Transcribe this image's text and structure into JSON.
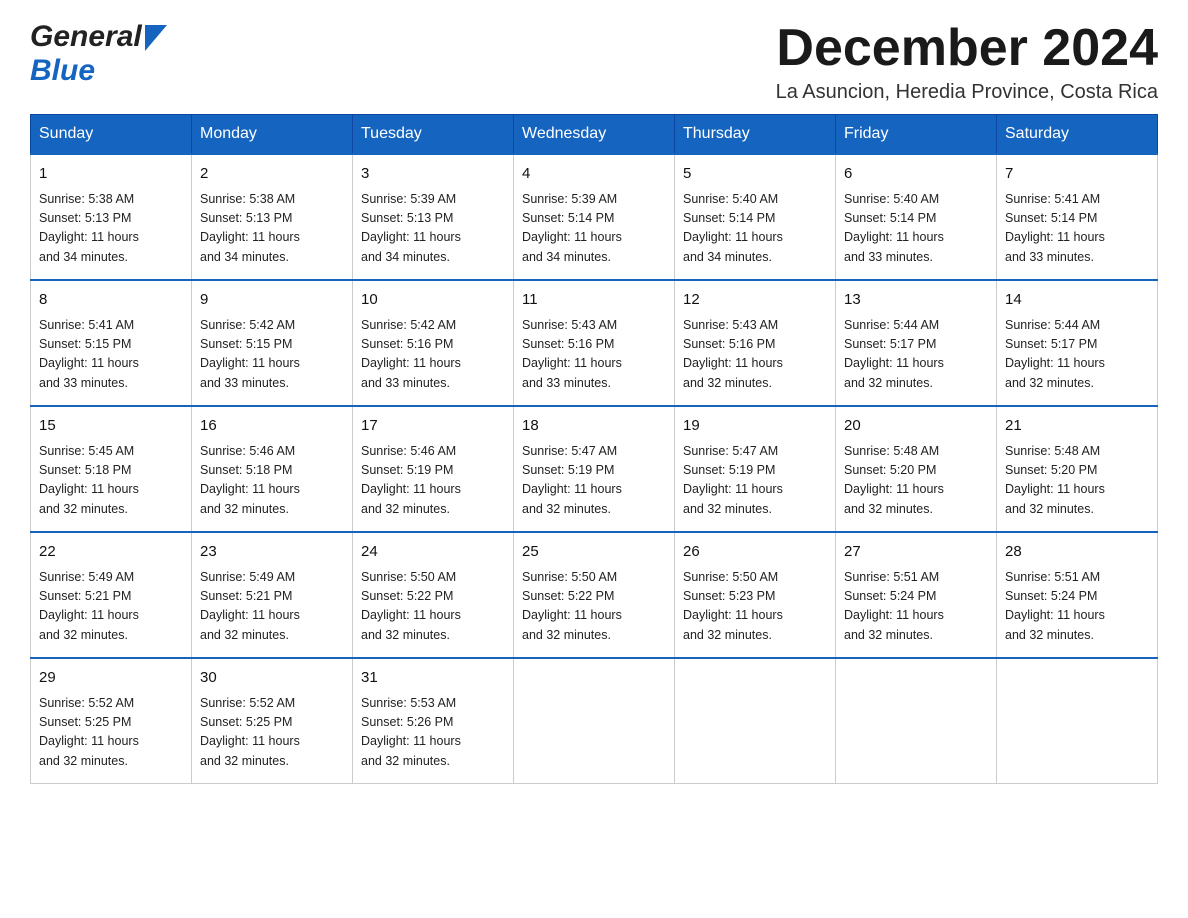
{
  "logo": {
    "general": "General",
    "blue": "Blue"
  },
  "header": {
    "month": "December 2024",
    "location": "La Asuncion, Heredia Province, Costa Rica"
  },
  "days_of_week": [
    "Sunday",
    "Monday",
    "Tuesday",
    "Wednesday",
    "Thursday",
    "Friday",
    "Saturday"
  ],
  "weeks": [
    [
      {
        "day": "1",
        "sunrise": "5:38 AM",
        "sunset": "5:13 PM",
        "daylight": "11 hours and 34 minutes."
      },
      {
        "day": "2",
        "sunrise": "5:38 AM",
        "sunset": "5:13 PM",
        "daylight": "11 hours and 34 minutes."
      },
      {
        "day": "3",
        "sunrise": "5:39 AM",
        "sunset": "5:13 PM",
        "daylight": "11 hours and 34 minutes."
      },
      {
        "day": "4",
        "sunrise": "5:39 AM",
        "sunset": "5:14 PM",
        "daylight": "11 hours and 34 minutes."
      },
      {
        "day": "5",
        "sunrise": "5:40 AM",
        "sunset": "5:14 PM",
        "daylight": "11 hours and 34 minutes."
      },
      {
        "day": "6",
        "sunrise": "5:40 AM",
        "sunset": "5:14 PM",
        "daylight": "11 hours and 33 minutes."
      },
      {
        "day": "7",
        "sunrise": "5:41 AM",
        "sunset": "5:14 PM",
        "daylight": "11 hours and 33 minutes."
      }
    ],
    [
      {
        "day": "8",
        "sunrise": "5:41 AM",
        "sunset": "5:15 PM",
        "daylight": "11 hours and 33 minutes."
      },
      {
        "day": "9",
        "sunrise": "5:42 AM",
        "sunset": "5:15 PM",
        "daylight": "11 hours and 33 minutes."
      },
      {
        "day": "10",
        "sunrise": "5:42 AM",
        "sunset": "5:16 PM",
        "daylight": "11 hours and 33 minutes."
      },
      {
        "day": "11",
        "sunrise": "5:43 AM",
        "sunset": "5:16 PM",
        "daylight": "11 hours and 33 minutes."
      },
      {
        "day": "12",
        "sunrise": "5:43 AM",
        "sunset": "5:16 PM",
        "daylight": "11 hours and 32 minutes."
      },
      {
        "day": "13",
        "sunrise": "5:44 AM",
        "sunset": "5:17 PM",
        "daylight": "11 hours and 32 minutes."
      },
      {
        "day": "14",
        "sunrise": "5:44 AM",
        "sunset": "5:17 PM",
        "daylight": "11 hours and 32 minutes."
      }
    ],
    [
      {
        "day": "15",
        "sunrise": "5:45 AM",
        "sunset": "5:18 PM",
        "daylight": "11 hours and 32 minutes."
      },
      {
        "day": "16",
        "sunrise": "5:46 AM",
        "sunset": "5:18 PM",
        "daylight": "11 hours and 32 minutes."
      },
      {
        "day": "17",
        "sunrise": "5:46 AM",
        "sunset": "5:19 PM",
        "daylight": "11 hours and 32 minutes."
      },
      {
        "day": "18",
        "sunrise": "5:47 AM",
        "sunset": "5:19 PM",
        "daylight": "11 hours and 32 minutes."
      },
      {
        "day": "19",
        "sunrise": "5:47 AM",
        "sunset": "5:19 PM",
        "daylight": "11 hours and 32 minutes."
      },
      {
        "day": "20",
        "sunrise": "5:48 AM",
        "sunset": "5:20 PM",
        "daylight": "11 hours and 32 minutes."
      },
      {
        "day": "21",
        "sunrise": "5:48 AM",
        "sunset": "5:20 PM",
        "daylight": "11 hours and 32 minutes."
      }
    ],
    [
      {
        "day": "22",
        "sunrise": "5:49 AM",
        "sunset": "5:21 PM",
        "daylight": "11 hours and 32 minutes."
      },
      {
        "day": "23",
        "sunrise": "5:49 AM",
        "sunset": "5:21 PM",
        "daylight": "11 hours and 32 minutes."
      },
      {
        "day": "24",
        "sunrise": "5:50 AM",
        "sunset": "5:22 PM",
        "daylight": "11 hours and 32 minutes."
      },
      {
        "day": "25",
        "sunrise": "5:50 AM",
        "sunset": "5:22 PM",
        "daylight": "11 hours and 32 minutes."
      },
      {
        "day": "26",
        "sunrise": "5:50 AM",
        "sunset": "5:23 PM",
        "daylight": "11 hours and 32 minutes."
      },
      {
        "day": "27",
        "sunrise": "5:51 AM",
        "sunset": "5:24 PM",
        "daylight": "11 hours and 32 minutes."
      },
      {
        "day": "28",
        "sunrise": "5:51 AM",
        "sunset": "5:24 PM",
        "daylight": "11 hours and 32 minutes."
      }
    ],
    [
      {
        "day": "29",
        "sunrise": "5:52 AM",
        "sunset": "5:25 PM",
        "daylight": "11 hours and 32 minutes."
      },
      {
        "day": "30",
        "sunrise": "5:52 AM",
        "sunset": "5:25 PM",
        "daylight": "11 hours and 32 minutes."
      },
      {
        "day": "31",
        "sunrise": "5:53 AM",
        "sunset": "5:26 PM",
        "daylight": "11 hours and 32 minutes."
      },
      null,
      null,
      null,
      null
    ]
  ],
  "labels": {
    "sunrise": "Sunrise:",
    "sunset": "Sunset:",
    "daylight": "Daylight:"
  }
}
